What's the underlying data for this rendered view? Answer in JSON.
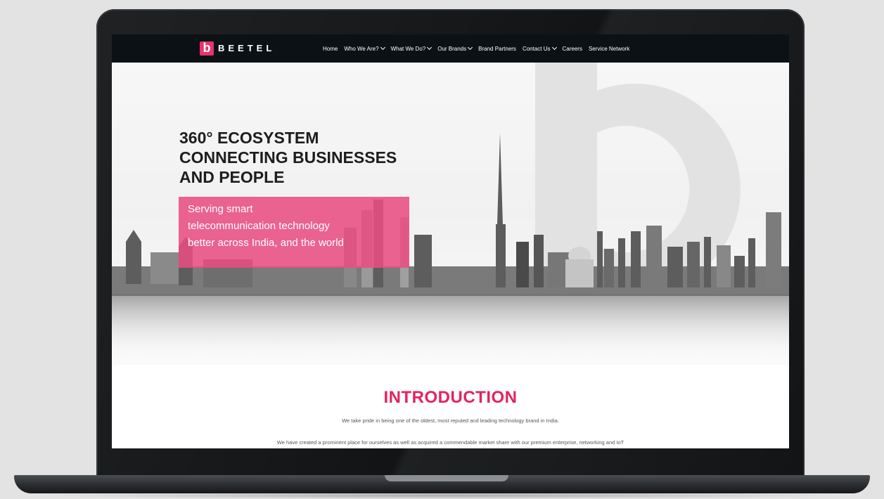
{
  "brand": {
    "logo_letter": "b",
    "name": "BEETEL",
    "accent_color": "#e8336e"
  },
  "nav": {
    "items": [
      {
        "label": "Home",
        "has_dropdown": false
      },
      {
        "label": "Who We Are?",
        "has_dropdown": true
      },
      {
        "label": "What We Do?",
        "has_dropdown": true
      },
      {
        "label": "Our Brands",
        "has_dropdown": true
      },
      {
        "label": "Brand Partners",
        "has_dropdown": false
      },
      {
        "label": "Contact Us",
        "has_dropdown": true
      },
      {
        "label": "Careers",
        "has_dropdown": false
      },
      {
        "label": "Service Network",
        "has_dropdown": false
      }
    ]
  },
  "hero": {
    "headline": [
      "360° ECOSYSTEM",
      "CONNECTING BUSINESSES",
      "AND PEOPLE"
    ],
    "tagline": [
      "Serving smart",
      "telecommunication technology",
      "better across India, and the world"
    ]
  },
  "intro": {
    "title": "INTRODUCTION",
    "paragraph1": "We take pride in being one of the oldest, most reputed and leading technology brand in India.",
    "paragraph2": "We have created a prominent place for ourselves as well as acquired a commendable market share with our premium enterprise, networking and IoT"
  }
}
